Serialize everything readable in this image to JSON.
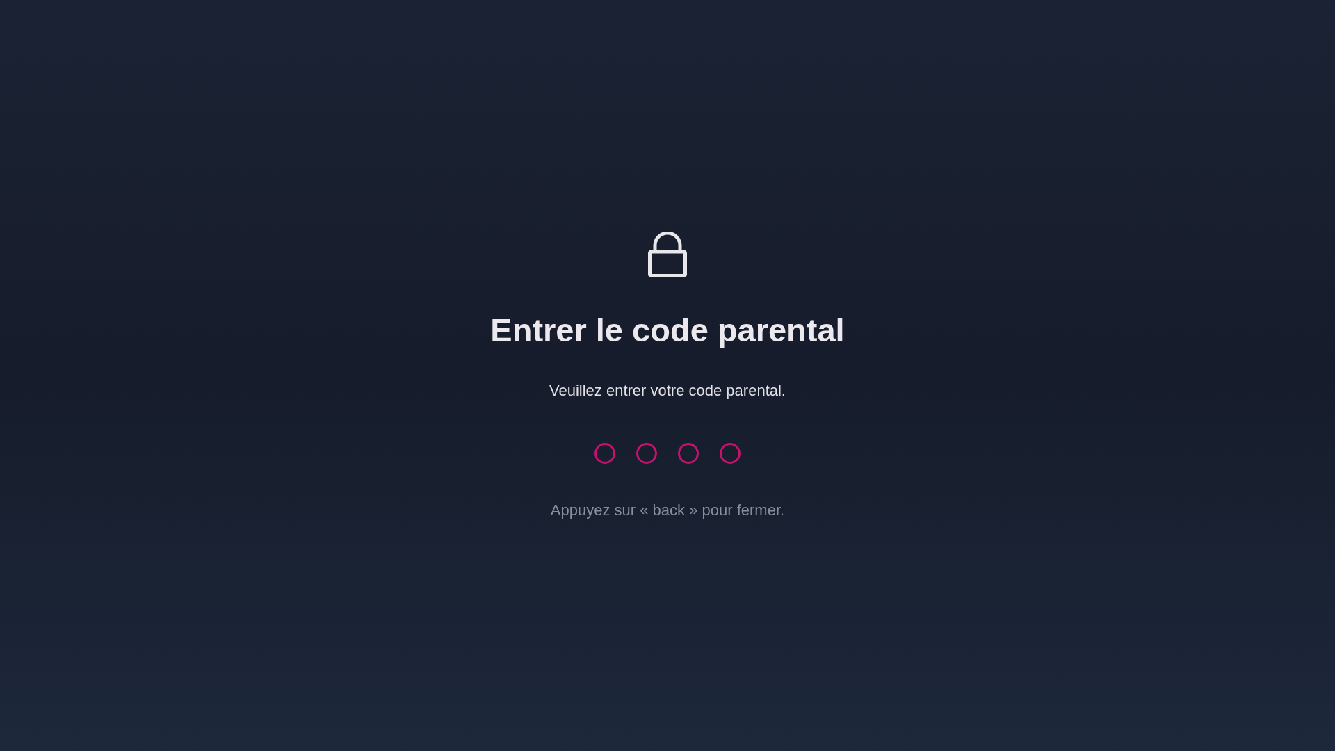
{
  "dialog": {
    "title": "Entrer le code parental",
    "message": "Veuillez entrer votre code parental.",
    "pin_dots": [
      {
        "filled": false
      },
      {
        "filled": false
      },
      {
        "filled": false
      },
      {
        "filled": false
      }
    ],
    "hint": "Appuyez sur « back » pour fermer."
  }
}
